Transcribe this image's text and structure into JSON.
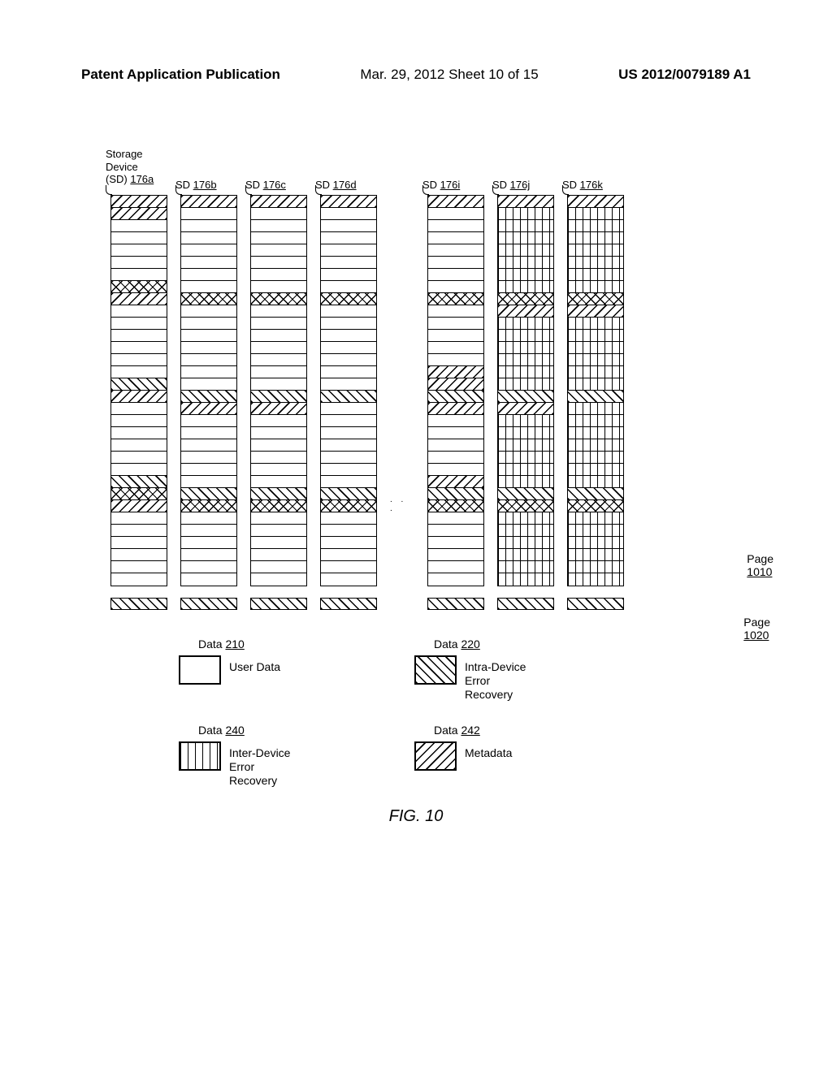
{
  "header": {
    "left": "Patent Application Publication",
    "middle": "Mar. 29, 2012  Sheet 10 of 15",
    "right": "US 2012/0079189 A1"
  },
  "devices": [
    {
      "id": "sd-176a",
      "label_prefix": "Storage Device (SD)",
      "ref": "176a",
      "rows": [
        "meta",
        "meta",
        "user",
        "user",
        "user",
        "user",
        "user",
        "cross",
        "meta",
        "user",
        "user",
        "user",
        "user",
        "user",
        "user",
        "intra",
        "meta",
        "user",
        "user",
        "user",
        "user",
        "user",
        "user",
        "intra",
        "cross",
        "meta",
        "user",
        "user",
        "user",
        "user",
        "user",
        "user"
      ],
      "detached": "intra"
    },
    {
      "id": "sd-176b",
      "label_prefix": "SD",
      "ref": "176b",
      "rows": [
        "meta",
        "user",
        "user",
        "user",
        "user",
        "user",
        "user",
        "user",
        "cross",
        "user",
        "user",
        "user",
        "user",
        "user",
        "user",
        "user",
        "intra",
        "meta",
        "user",
        "user",
        "user",
        "user",
        "user",
        "user",
        "intra",
        "cross",
        "user",
        "user",
        "user",
        "user",
        "user",
        "user"
      ],
      "detached": "intra"
    },
    {
      "id": "sd-176c",
      "label_prefix": "SD",
      "ref": "176c",
      "rows": [
        "meta",
        "user",
        "user",
        "user",
        "user",
        "user",
        "user",
        "user",
        "cross",
        "user",
        "user",
        "user",
        "user",
        "user",
        "user",
        "user",
        "intra",
        "meta",
        "user",
        "user",
        "user",
        "user",
        "user",
        "user",
        "intra",
        "cross",
        "user",
        "user",
        "user",
        "user",
        "user",
        "user"
      ],
      "detached": "intra"
    },
    {
      "id": "sd-176d",
      "label_prefix": "SD",
      "ref": "176d",
      "rows": [
        "meta",
        "user",
        "user",
        "user",
        "user",
        "user",
        "user",
        "user",
        "cross",
        "user",
        "user",
        "user",
        "user",
        "user",
        "user",
        "user",
        "intra",
        "user",
        "user",
        "user",
        "user",
        "user",
        "user",
        "user",
        "intra",
        "cross",
        "user",
        "user",
        "user",
        "user",
        "user",
        "user"
      ],
      "detached": "intra"
    },
    {
      "id": "sd-176i",
      "label_prefix": "SD",
      "ref": "176i",
      "rows": [
        "meta",
        "user",
        "user",
        "user",
        "user",
        "user",
        "user",
        "user",
        "cross",
        "user",
        "user",
        "user",
        "user",
        "user",
        "meta",
        "meta",
        "intra",
        "meta",
        "user",
        "user",
        "user",
        "user",
        "user",
        "meta",
        "intra",
        "cross",
        "user",
        "user",
        "user",
        "user",
        "user",
        "user"
      ],
      "detached": "intra"
    },
    {
      "id": "sd-176j",
      "label_prefix": "SD",
      "ref": "176j",
      "rows": [
        "meta",
        "inter",
        "inter",
        "inter",
        "inter",
        "inter",
        "inter",
        "inter",
        "cross",
        "meta",
        "inter",
        "inter",
        "inter",
        "inter",
        "inter",
        "inter",
        "intra",
        "meta",
        "inter",
        "inter",
        "inter",
        "inter",
        "inter",
        "inter",
        "intra",
        "cross",
        "inter",
        "inter",
        "inter",
        "inter",
        "inter",
        "inter"
      ],
      "detached": "intra"
    },
    {
      "id": "sd-176k",
      "label_prefix": "SD",
      "ref": "176k",
      "rows": [
        "meta",
        "inter",
        "inter",
        "inter",
        "inter",
        "inter",
        "inter",
        "inter",
        "cross",
        "meta",
        "inter",
        "inter",
        "inter",
        "inter",
        "inter",
        "inter",
        "intra",
        "inter",
        "inter",
        "inter",
        "inter",
        "inter",
        "inter",
        "inter",
        "intra",
        "cross",
        "inter",
        "inter",
        "inter",
        "inter",
        "inter",
        "inter"
      ],
      "detached": "intra"
    }
  ],
  "ellipsis": ". . .",
  "callouts": {
    "page_1010": {
      "label": "Page",
      "ref": "1010"
    },
    "page_1020": {
      "label": "Page",
      "ref": "1020"
    }
  },
  "legend": {
    "items": [
      {
        "id": "data-210",
        "top": "Data",
        "ref": "210",
        "fill": "user",
        "text": "User Data"
      },
      {
        "id": "data-220",
        "top": "Data",
        "ref": "220",
        "fill": "intra",
        "text": "Intra-Device Error Recovery"
      },
      {
        "id": "data-240",
        "top": "Data",
        "ref": "240",
        "fill": "inter",
        "text": "Inter-Device Error Recovery"
      },
      {
        "id": "data-242",
        "top": "Data",
        "ref": "242",
        "fill": "meta",
        "text": "Metadata"
      }
    ]
  },
  "figure_caption": "FIG. 10"
}
